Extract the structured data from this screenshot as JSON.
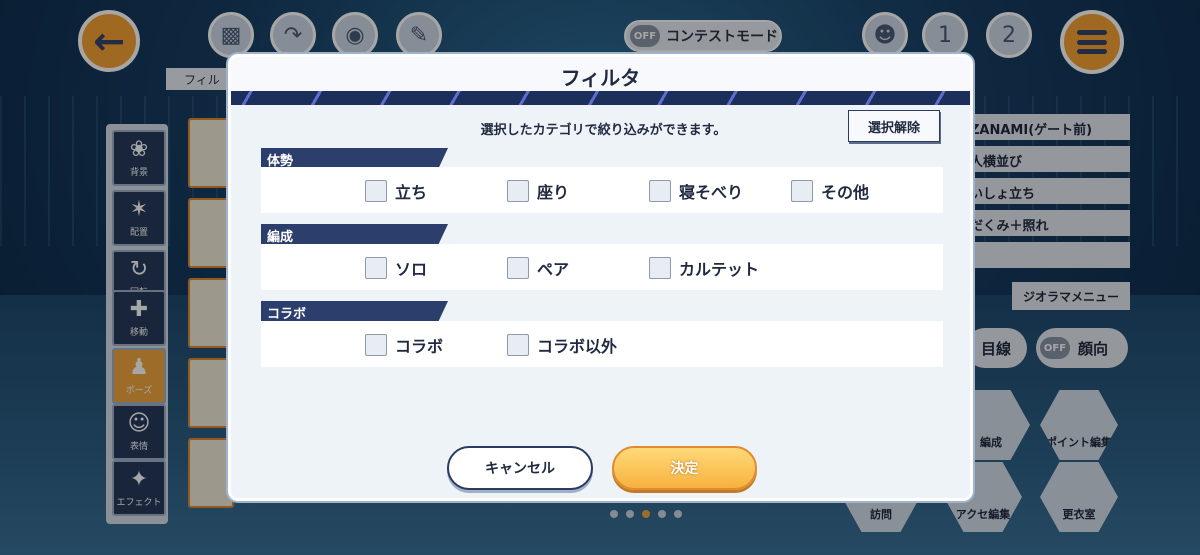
{
  "topbar": {
    "contest_mode_state": "OFF",
    "contest_mode_label": "コンテストモード",
    "badge_1": "1",
    "badge_2": "2"
  },
  "left_tools": [
    {
      "label": "背景",
      "icon": "palm-tree-icon"
    },
    {
      "label": "配置",
      "icon": "figures-icon"
    },
    {
      "label": "回転",
      "icon": "rotate-icon"
    },
    {
      "label": "移動",
      "icon": "move-arrows-icon"
    },
    {
      "label": "ポーズ",
      "icon": "pose-figure-icon",
      "active": true
    },
    {
      "label": "表情",
      "icon": "face-icon"
    },
    {
      "label": "エフェクト",
      "icon": "sparkle-icon"
    }
  ],
  "filter_tab": "フィル",
  "right_list": [
    "ZANAMI(ゲート前)",
    "人横並び",
    "いしょ立ち",
    "だくみ＋照れ",
    ""
  ],
  "diorama_menu": "ジオラマメニュー",
  "gaze_label": "目線",
  "face_state": "OFF",
  "face_label": "顔向",
  "hex_buttons": [
    "編成",
    "ポイント編集",
    "訪問",
    "アクセ編集",
    "更衣室"
  ],
  "modal": {
    "title": "フィルタ",
    "subtitle": "選択したカテゴリで絞り込みができます。",
    "clear_label": "選択解除",
    "sections": [
      {
        "title": "体勢",
        "options": [
          "立ち",
          "座り",
          "寝そべり",
          "その他"
        ]
      },
      {
        "title": "編成",
        "options": [
          "ソロ",
          "ペア",
          "カルテット"
        ]
      },
      {
        "title": "コラボ",
        "options": [
          "コラボ",
          "コラボ以外"
        ]
      }
    ],
    "cancel_label": "キャンセル",
    "ok_label": "決定"
  },
  "colors": {
    "accent_orange": "#f5a233",
    "navy": "#2b3e6c"
  }
}
